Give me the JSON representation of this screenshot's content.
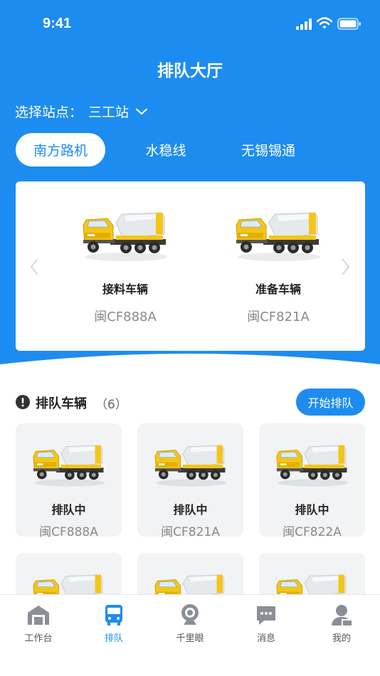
{
  "status_bar": {
    "time": "9:41"
  },
  "page_title": "排队大厅",
  "station": {
    "label": "选择站点：",
    "value": "三工站"
  },
  "tabs": [
    "南方路机",
    "水稳线",
    "无锡锡通"
  ],
  "featured": [
    {
      "label": "接料车辆",
      "plate": "闽CF888A"
    },
    {
      "label": "准备车辆",
      "plate": "闽CF821A"
    }
  ],
  "queue_section": {
    "title": "排队车辆",
    "count": "（6）",
    "start_button": "开始排队"
  },
  "queue": [
    {
      "status": "排队中",
      "plate": "闽CF888A"
    },
    {
      "status": "排队中",
      "plate": "闽CF821A"
    },
    {
      "status": "排队中",
      "plate": "闽CF822A"
    },
    {
      "status": "",
      "plate": ""
    },
    {
      "status": "",
      "plate": ""
    },
    {
      "status": "",
      "plate": ""
    }
  ],
  "tabbar": [
    {
      "label": "工作台",
      "icon": "workbench-icon",
      "active": false
    },
    {
      "label": "排队",
      "icon": "bus-icon",
      "active": true
    },
    {
      "label": "千里眼",
      "icon": "camera-icon",
      "active": false
    },
    {
      "label": "消息",
      "icon": "message-icon",
      "active": false
    },
    {
      "label": "我的",
      "icon": "user-icon",
      "active": false
    }
  ],
  "colors": {
    "primary": "#1d8cf0",
    "card_bg": "#f2f3f5",
    "truck_yellow": "#f5c518"
  }
}
